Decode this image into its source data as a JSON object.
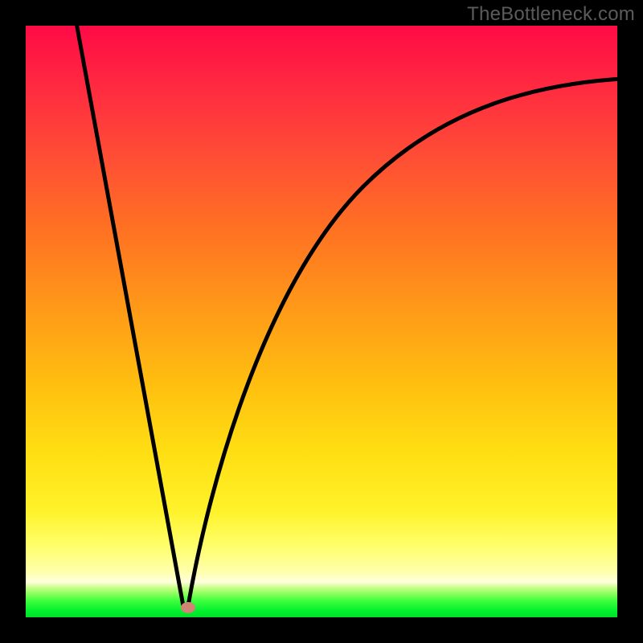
{
  "attribution": "TheBottleneck.com",
  "colors": {
    "frame_background": "#000000",
    "gradient_top": "#ff0a46",
    "gradient_mid": "#ffde12",
    "gradient_bottom": "#00e02a",
    "curve": "#000000",
    "marker": "#cf8476",
    "attribution_text": "#5b5b5b"
  },
  "chart_data": {
    "type": "line",
    "title": "",
    "xlabel": "",
    "ylabel": "",
    "xlim": [
      0,
      100
    ],
    "ylim": [
      0,
      100
    ],
    "grid": false,
    "legend": false,
    "annotations": [
      {
        "name": "optimal-point",
        "x": 27,
        "y": 0
      }
    ],
    "series": [
      {
        "name": "left-branch",
        "x": [
          8,
          12,
          16,
          20,
          24,
          27
        ],
        "y": [
          100,
          80,
          60,
          40,
          20,
          0
        ]
      },
      {
        "name": "right-branch",
        "x": [
          27,
          30,
          35,
          40,
          45,
          50,
          55,
          60,
          65,
          70,
          75,
          80,
          85,
          90,
          95,
          100
        ],
        "y": [
          0,
          18,
          38,
          52,
          62,
          69,
          74,
          78,
          81,
          83.5,
          85.5,
          87,
          88.3,
          89.3,
          90,
          90.5
        ]
      }
    ],
    "background_gradient": {
      "direction": "vertical",
      "stops": [
        {
          "pos": 0.0,
          "color": "#ff0a46"
        },
        {
          "pos": 0.35,
          "color": "#ff7322"
        },
        {
          "pos": 0.6,
          "color": "#ffbd10"
        },
        {
          "pos": 0.88,
          "color": "#ffff6b"
        },
        {
          "pos": 0.95,
          "color": "#8cff5e"
        },
        {
          "pos": 1.0,
          "color": "#00e02a"
        }
      ]
    }
  }
}
